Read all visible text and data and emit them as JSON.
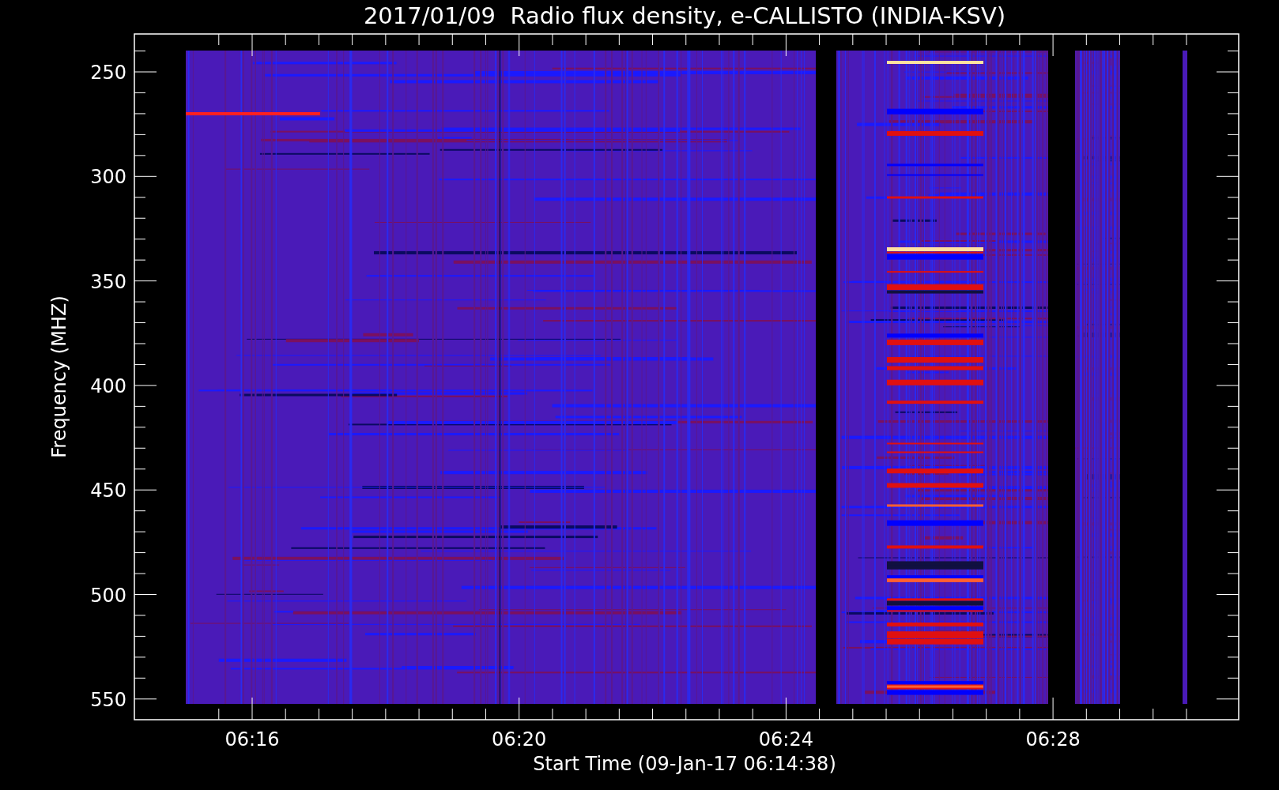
{
  "title": "2017/01/09  Radio flux density, e-CALLISTO (INDIA-KSV)",
  "y_axis": {
    "label": "Frequency (MHZ)",
    "ticks": [
      "250",
      "300",
      "350",
      "400",
      "450",
      "500",
      "550"
    ]
  },
  "x_axis": {
    "label": "Start Time (09-Jan-17 06:14:38)",
    "ticks": [
      "06:16",
      "06:20",
      "06:24",
      "06:28"
    ]
  }
}
